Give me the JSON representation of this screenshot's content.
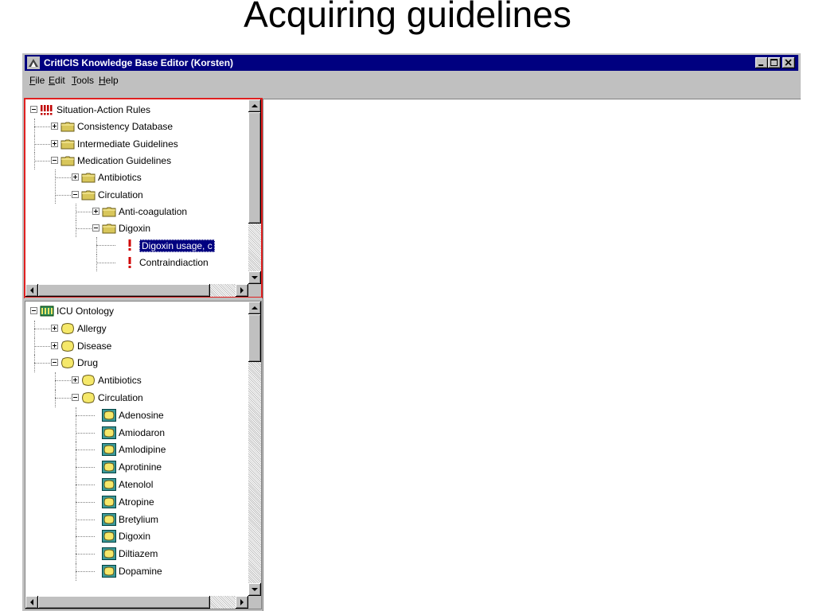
{
  "slide_title": "Acquiring guidelines",
  "window": {
    "title": "CritICIS Knowledge Base Editor (Korsten)",
    "colors": {
      "titlebar": "#000080",
      "highlight": "#e02020",
      "folder": "#d8c65a",
      "concept": "#f5e86a"
    }
  },
  "menu": [
    {
      "label": "File",
      "underline": "F"
    },
    {
      "label": "Edit",
      "underline": "E"
    },
    {
      "label": "Tools",
      "underline": "T"
    },
    {
      "label": "Help",
      "underline": "H"
    }
  ],
  "rules_tree": [
    {
      "label": "Situation-Action Rules",
      "depth": 0,
      "expander": "minus",
      "icon": "rules-icon"
    },
    {
      "label": "Consistency Database",
      "depth": 1,
      "expander": "plus",
      "icon": "folder-icon"
    },
    {
      "label": "Intermediate Guidelines",
      "depth": 1,
      "expander": "plus",
      "icon": "folder-icon"
    },
    {
      "label": "Medication Guidelines",
      "depth": 1,
      "expander": "minus",
      "icon": "folder-icon"
    },
    {
      "label": "Antibiotics",
      "depth": 2,
      "expander": "plus",
      "icon": "folder-icon"
    },
    {
      "label": "Circulation",
      "depth": 2,
      "expander": "minus",
      "icon": "folder-icon"
    },
    {
      "label": "Anti-coagulation",
      "depth": 3,
      "expander": "plus",
      "icon": "folder-icon"
    },
    {
      "label": "Digoxin",
      "depth": 3,
      "expander": "minus",
      "icon": "folder-icon"
    },
    {
      "label": "Digoxin usage, c",
      "depth": 4,
      "expander": "none",
      "icon": "exclamation-icon",
      "selected": true
    },
    {
      "label": "Contraindiaction",
      "depth": 4,
      "expander": "none",
      "icon": "exclamation-icon"
    }
  ],
  "ontology_tree": [
    {
      "label": "ICU Ontology",
      "depth": 0,
      "expander": "minus",
      "icon": "ontology-icon"
    },
    {
      "label": "Allergy",
      "depth": 1,
      "expander": "plus",
      "icon": "concept-icon"
    },
    {
      "label": "Disease",
      "depth": 1,
      "expander": "plus",
      "icon": "concept-icon"
    },
    {
      "label": "Drug",
      "depth": 1,
      "expander": "minus",
      "icon": "concept-icon"
    },
    {
      "label": "Antibiotics",
      "depth": 2,
      "expander": "plus",
      "icon": "concept-icon"
    },
    {
      "label": "Circulation",
      "depth": 2,
      "expander": "minus",
      "icon": "concept-icon"
    },
    {
      "label": "Adenosine",
      "depth": 3,
      "expander": "none",
      "icon": "instance-icon"
    },
    {
      "label": "Amiodaron",
      "depth": 3,
      "expander": "none",
      "icon": "instance-icon"
    },
    {
      "label": "Amlodipine",
      "depth": 3,
      "expander": "none",
      "icon": "instance-icon"
    },
    {
      "label": "Aprotinine",
      "depth": 3,
      "expander": "none",
      "icon": "instance-icon"
    },
    {
      "label": "Atenolol",
      "depth": 3,
      "expander": "none",
      "icon": "instance-icon"
    },
    {
      "label": "Atropine",
      "depth": 3,
      "expander": "none",
      "icon": "instance-icon"
    },
    {
      "label": "Bretylium",
      "depth": 3,
      "expander": "none",
      "icon": "instance-icon"
    },
    {
      "label": "Digoxin",
      "depth": 3,
      "expander": "none",
      "icon": "instance-icon"
    },
    {
      "label": "Diltiazem",
      "depth": 3,
      "expander": "none",
      "icon": "instance-icon"
    },
    {
      "label": "Dopamine",
      "depth": 3,
      "expander": "none",
      "icon": "instance-icon"
    }
  ]
}
